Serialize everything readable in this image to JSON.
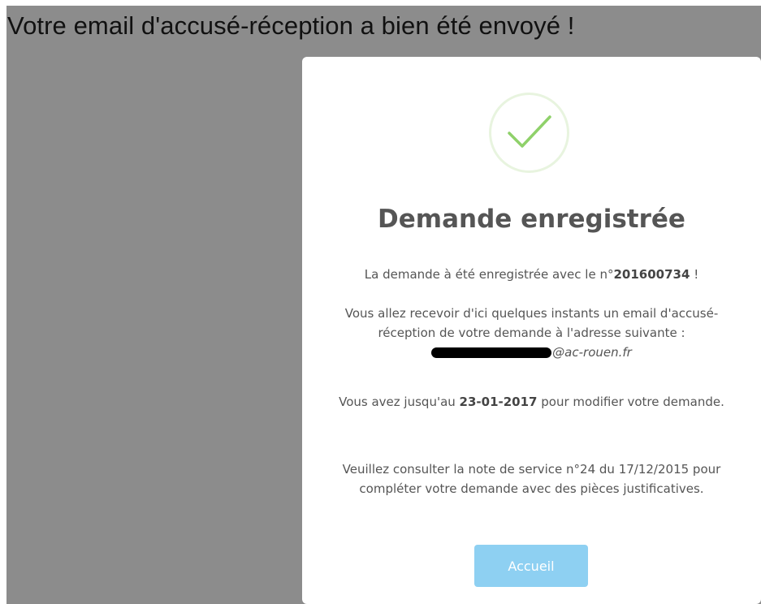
{
  "banner": {
    "message": "Votre email d'accusé-réception a bien été envoyé !"
  },
  "modal": {
    "icon": "checkmark-icon",
    "title": "Demande enregistrée",
    "registered_prefix": "La demande à été enregistrée avec le n°",
    "request_number": "201600734",
    "registered_suffix": " !",
    "email_notice": "Vous allez recevoir d'ici quelques instants un email d'accusé-réception de votre demande à l'adresse suivante :",
    "email_domain": "@ac-rouen.fr",
    "deadline_prefix": "Vous avez jusqu'au ",
    "deadline_date": "23-01-2017",
    "deadline_suffix": " pour modifier votre demande.",
    "service_note": "Veuillez consulter la note de service n°24 du 17/12/2015 pour compléter votre demande avec des pièces justificatives.",
    "home_button": "Accueil"
  },
  "colors": {
    "overlay": "#8c8c8c",
    "check": "#8fd16a",
    "check_ring": "#e8f4df",
    "button": "#8ed0f2",
    "text": "#555555"
  }
}
